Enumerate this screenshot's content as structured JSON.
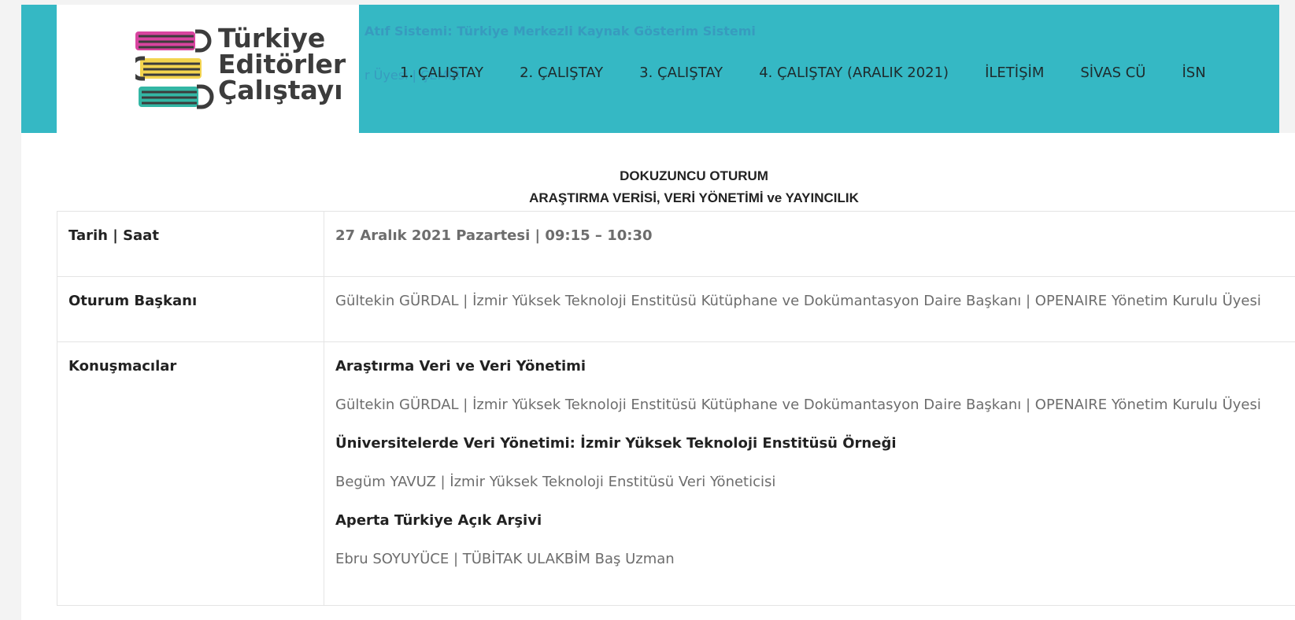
{
  "header": {
    "logo": {
      "line1": "Türkiye",
      "line2": "Editörler",
      "line3": "Çalıştayı",
      "book_colors": [
        "#d8449f",
        "#f3d44f",
        "#33b6a4"
      ]
    },
    "ghost_line1": "Atıf Sistemi: Türkiye Merkezli Kaynak Gösterim Sistemi",
    "ghost_line2": "r Üyesi | ÇEMİR",
    "nav": [
      {
        "label": "1. ÇALIŞTAY"
      },
      {
        "label": "2. ÇALIŞTAY"
      },
      {
        "label": "3. ÇALIŞTAY"
      },
      {
        "label": "4. ÇALIŞTAY (ARALIK 2021)"
      },
      {
        "label": "İLETİŞİM"
      },
      {
        "label": "SİVAS CÜ"
      },
      {
        "label": "İSN"
      }
    ],
    "background_color": "#35b8c4"
  },
  "session": {
    "title": "DOKUZUNCU OTURUM",
    "subtitle": "ARAŞTIRMA VERİSİ, VERİ YÖNETİMİ ve YAYINCILIK"
  },
  "table": {
    "date_label": "Tarih | Saat",
    "date_value": "27 Aralık 2021 Pazartesi | 09:15 – 10:30",
    "chair_label": "Oturum Başkanı",
    "chair_value": "Gültekin GÜRDAL | İzmir Yüksek Teknoloji Enstitüsü Kütüphane ve Dokümantasyon Daire Başkanı | OPENAIRE Yönetim Kurulu Üyesi",
    "speakers_label": "Konuşmacılar",
    "speakers": [
      {
        "title": "Araştırma Veri ve Veri Yönetimi",
        "person": "Gültekin GÜRDAL | İzmir Yüksek Teknoloji Enstitüsü Kütüphane ve Dokümantasyon Daire Başkanı | OPENAIRE Yönetim Kurulu Üyesi"
      },
      {
        "title": "Üniversitelerde Veri Yönetimi: İzmir Yüksek Teknoloji Enstitüsü Örneği",
        "person": "Begüm YAVUZ | İzmir Yüksek Teknoloji Enstitüsü Veri Yöneticisi"
      },
      {
        "title": "Aperta Türkiye Açık Arşivi",
        "person": "Ebru SOYUYÜCE   | TÜBİTAK ULAKBİM Baş Uzman"
      }
    ]
  }
}
